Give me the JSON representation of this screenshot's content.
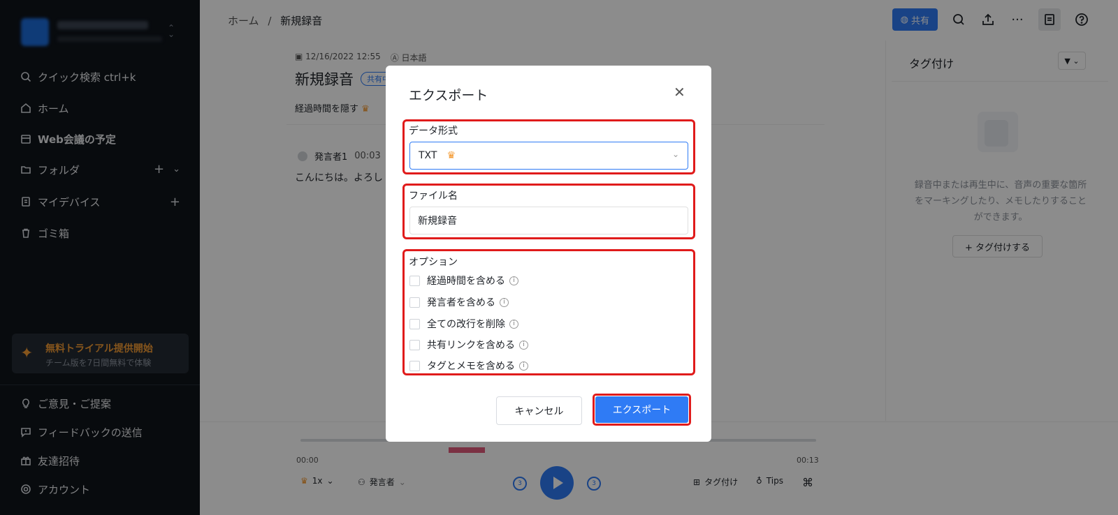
{
  "sidebar": {
    "items": [
      {
        "label": "クイック検索 ctrl+k"
      },
      {
        "label": "ホーム"
      },
      {
        "label": "Web会議の予定"
      },
      {
        "label": "フォルダ"
      },
      {
        "label": "マイデバイス"
      },
      {
        "label": "ゴミ箱"
      }
    ],
    "trial": {
      "title": "無料トライアル提供開始",
      "subtitle": "チーム版を7日間無料で体験"
    },
    "bottom_items": [
      {
        "label": "ご意見・ご提案"
      },
      {
        "label": "フィードバックの送信"
      },
      {
        "label": "友達招待"
      },
      {
        "label": "アカウント"
      }
    ]
  },
  "header": {
    "breadcrumb_home": "ホーム",
    "breadcrumb_sep": "/",
    "breadcrumb_current": "新規録音",
    "share_label": "共有"
  },
  "recording": {
    "date": "12/16/2022 12:55",
    "language": "日本語",
    "title": "新規録音",
    "badge": "共有中",
    "hide_elapsed": "経過時間を隠す",
    "speaker": "発言者1",
    "time": "00:03",
    "text": "こんにちは。よろし"
  },
  "right_panel": {
    "title": "タグ付け",
    "empty_text": "録音中または再生中に、音声の重要な箇所をマーキングしたり、メモしたりすることができます。",
    "add_tag": "+ タグ付けする"
  },
  "player": {
    "start": "00:00",
    "end": "00:13",
    "speed": "1x",
    "speaker": "発言者",
    "tag": "タグ付け",
    "tips": "Tips",
    "skip_back": "3",
    "skip_fwd": "3"
  },
  "modal": {
    "title": "エクスポート",
    "format_label": "データ形式",
    "format_value": "TXT",
    "filename_label": "ファイル名",
    "filename_value": "新規録音",
    "options_label": "オプション",
    "options": [
      {
        "label": "経過時間を含める"
      },
      {
        "label": "発言者を含める"
      },
      {
        "label": "全ての改行を削除"
      },
      {
        "label": "共有リンクを含める"
      },
      {
        "label": "タグとメモを含める"
      }
    ],
    "cancel": "キャンセル",
    "export": "エクスポート"
  },
  "colors": {
    "accent": "#2f7bf5",
    "highlight": "#e01b1b",
    "sidebar_bg": "#0f141b"
  }
}
